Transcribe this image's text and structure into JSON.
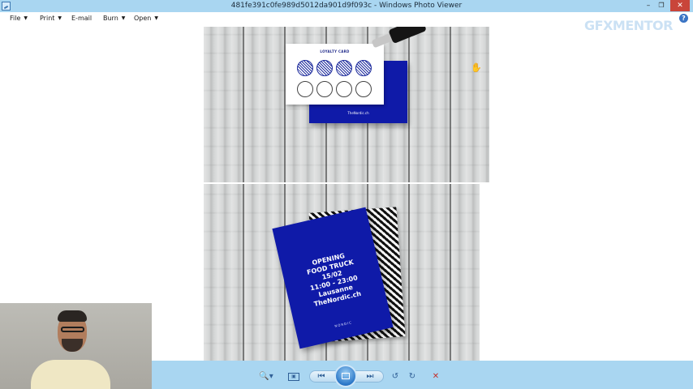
{
  "window": {
    "title": "481fe391c0fe989d5012da901d9f093c - Windows Photo Viewer",
    "minimize": "–",
    "maximize": "❐",
    "close": "✕"
  },
  "menu": {
    "items": [
      {
        "label": "File",
        "has_dropdown": true
      },
      {
        "label": "Print",
        "has_dropdown": true
      },
      {
        "label": "E-mail",
        "has_dropdown": false
      },
      {
        "label": "Burn",
        "has_dropdown": true
      },
      {
        "label": "Open",
        "has_dropdown": true
      }
    ],
    "dropdown_glyph": "▼",
    "help_icon": "?"
  },
  "watermark": "GFXMENTOR",
  "photo": {
    "loyalty_card_title": "LOYALTY CARD",
    "loyalty_card_brand": "TheNordic.ch",
    "stamps_filled": 4,
    "stamps_total": 8,
    "poster_lines": [
      "OPENING",
      "FOOD TRUCK",
      "15/02",
      "11:00 - 23:00",
      "Lausanne",
      "TheNordic.ch"
    ],
    "poster_logo": "NORDIC",
    "brand_color": "#0f1aa8"
  },
  "toolbar": {
    "zoom": "🔍▾",
    "actual_size": "▣",
    "previous": "⏮",
    "slideshow": "slideshow-icon",
    "next": "⏭",
    "rotate_left": "↺",
    "rotate_right": "↻",
    "delete": "✕",
    "background_color": "#a9d6f1"
  },
  "cursor": "hand-cursor-icon"
}
